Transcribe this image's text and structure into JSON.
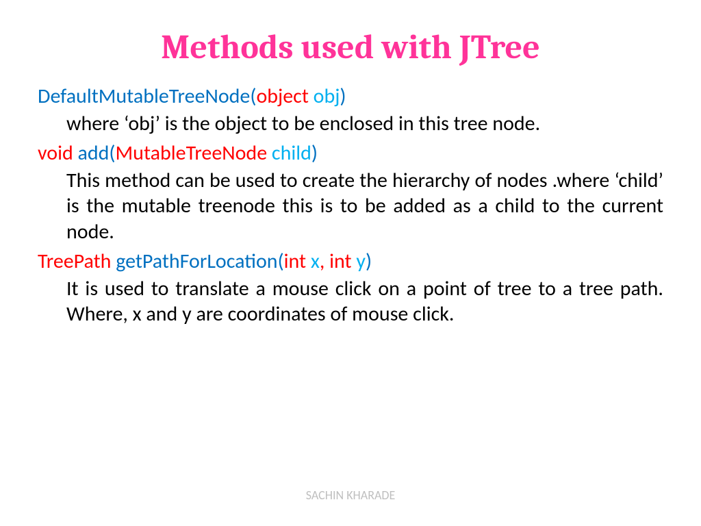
{
  "title": "Methods used with JTree",
  "methods": [
    {
      "sig": [
        {
          "t": "DefaultMutableTreeNode(",
          "c": "tok-blue"
        },
        {
          "t": "object ",
          "c": "tok-red"
        },
        {
          "t": "obj",
          "c": "tok-lblue"
        },
        {
          "t": ")",
          "c": "tok-blue"
        }
      ],
      "desc": "where ‘obj’ is the object to be enclosed in this tree node."
    },
    {
      "sig": [
        {
          "t": "void ",
          "c": "tok-red"
        },
        {
          "t": "add(",
          "c": "tok-blue"
        },
        {
          "t": "MutableTreeNode ",
          "c": "tok-red"
        },
        {
          "t": "child",
          "c": "tok-lblue"
        },
        {
          "t": ")",
          "c": "tok-blue"
        }
      ],
      "desc": "This method can be used to create the hierarchy of nodes .where ‘child’ is the mutable treenode this is to be added as a child to the current node."
    },
    {
      "sig": [
        {
          "t": "TreePath ",
          "c": "tok-red"
        },
        {
          "t": "getPathForLocation(",
          "c": "tok-blue"
        },
        {
          "t": "int ",
          "c": "tok-red"
        },
        {
          "t": "x",
          "c": "tok-lblue"
        },
        {
          "t": ", ",
          "c": "tok-red"
        },
        {
          "t": "int ",
          "c": "tok-red"
        },
        {
          "t": "y",
          "c": "tok-lblue"
        },
        {
          "t": ")",
          "c": "tok-blue"
        }
      ],
      "desc": " It is used to translate a mouse click on a point of tree to a tree path. Where, x and y are coordinates of mouse click."
    }
  ],
  "footer": "SACHIN KHARADE"
}
